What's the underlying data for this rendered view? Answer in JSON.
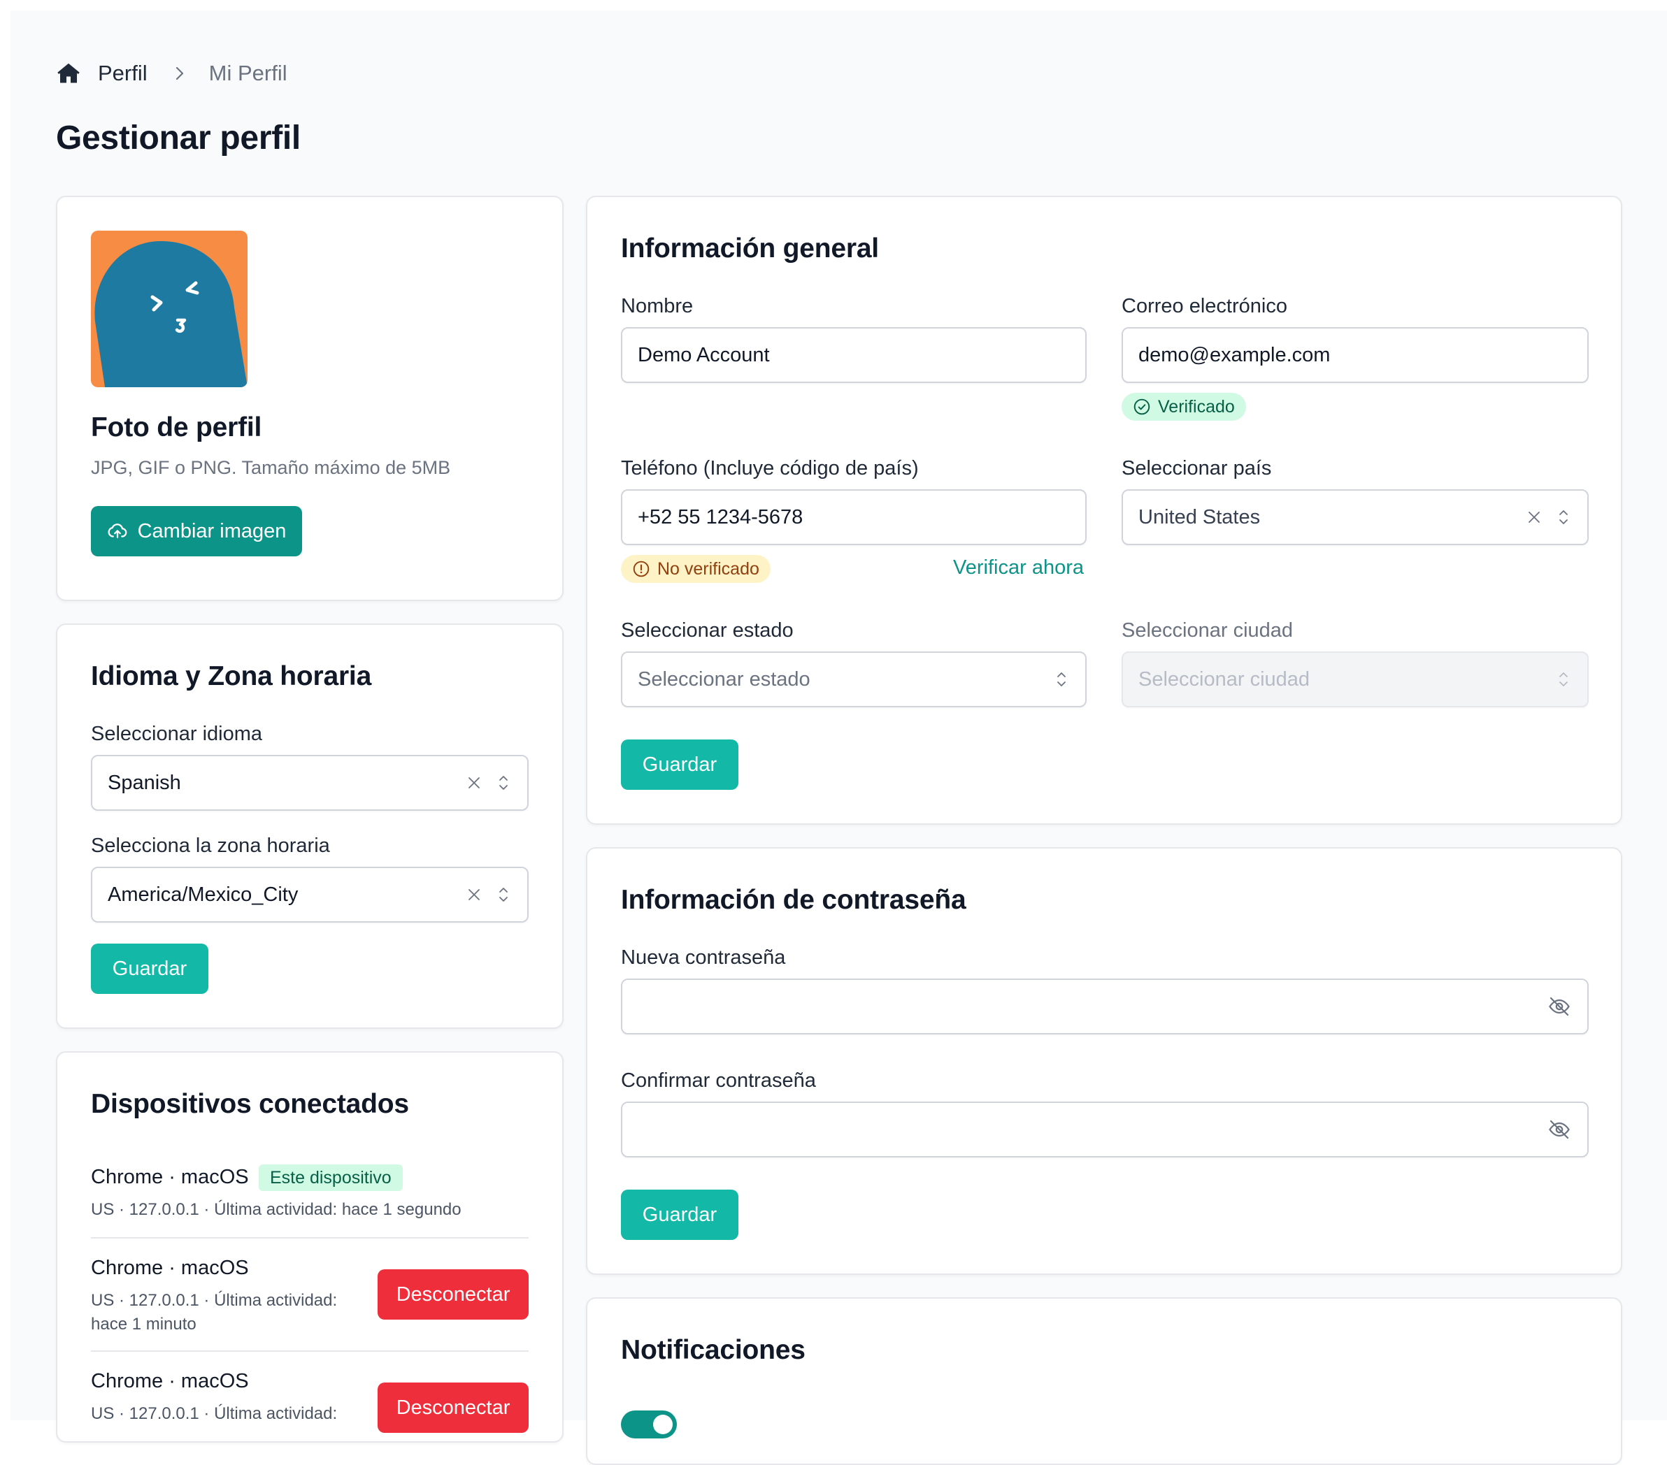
{
  "breadcrumb": {
    "root": "Perfil",
    "current": "Mi Perfil"
  },
  "page": {
    "title": "Gestionar perfil"
  },
  "photo_card": {
    "title": "Foto de perfil",
    "hint": "JPG, GIF o PNG. Tamaño máximo de 5MB",
    "change_button": "Cambiar imagen"
  },
  "locale_card": {
    "title": "Idioma y Zona horaria",
    "language_label": "Seleccionar idioma",
    "language_value": "Spanish",
    "timezone_label": "Selecciona la zona horaria",
    "timezone_value": "America/Mexico_City",
    "save_button": "Guardar"
  },
  "devices_card": {
    "title": "Dispositivos conectados",
    "this_device_tag": "Este dispositivo",
    "disconnect_label": "Desconectar",
    "devices": [
      {
        "name": "Chrome · macOS",
        "meta": "US · 127.0.0.1 · Última actividad: hace 1 segundo"
      },
      {
        "name": "Chrome · macOS",
        "meta_line1": "US · 127.0.0.1 · Última actividad:",
        "meta_line2": "hace 1 minuto"
      },
      {
        "name": "Chrome · macOS",
        "meta_line1": "US · 127.0.0.1 · Última actividad:"
      }
    ]
  },
  "general_card": {
    "title": "Información general",
    "name_label": "Nombre",
    "name_value": "Demo Account",
    "email_label": "Correo electrónico",
    "email_value": "demo@example.com",
    "email_status": "Verificado",
    "phone_label": "Teléfono (Incluye código de país)",
    "phone_value": "+52 55 1234-5678",
    "phone_status": "No verificado",
    "verify_link": "Verificar ahora",
    "country_label": "Seleccionar país",
    "country_value": "United States",
    "state_label": "Seleccionar estado",
    "state_placeholder": "Seleccionar estado",
    "city_label": "Seleccionar ciudad",
    "city_placeholder": "Seleccionar ciudad",
    "save_button": "Guardar"
  },
  "password_card": {
    "title": "Información de contraseña",
    "new_label": "Nueva contraseña",
    "confirm_label": "Confirmar contraseña",
    "save_button": "Guardar"
  },
  "notifications_card": {
    "title": "Notificaciones"
  },
  "colors": {
    "primary": "#14b8a6",
    "primary_dark": "#0d9488",
    "danger": "#ef2e3b",
    "avatar_bg": "#f78c45",
    "avatar_fg": "#1e7aa0"
  }
}
